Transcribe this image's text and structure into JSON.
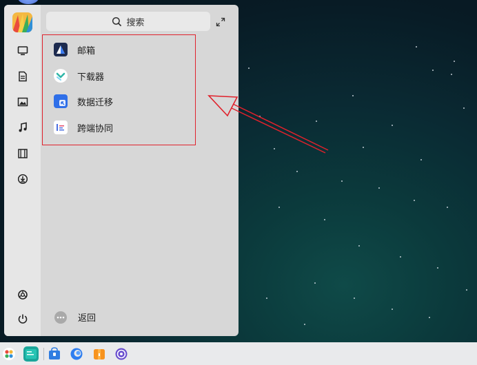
{
  "search": {
    "label": "搜索",
    "icon": "search-icon"
  },
  "sidebar": {
    "icons": [
      "app-logo-icon",
      "computer-icon",
      "document-icon",
      "image-icon",
      "music-icon",
      "video-icon",
      "download-icon",
      "settings-icon",
      "power-icon"
    ]
  },
  "apps": [
    {
      "label": "邮箱",
      "icon": "mail-app-icon"
    },
    {
      "label": "下载器",
      "icon": "downloader-app-icon"
    },
    {
      "label": "数据迁移",
      "icon": "data-migration-app-icon"
    },
    {
      "label": "跨端协同",
      "icon": "cross-device-app-icon"
    }
  ],
  "back": {
    "label": "返回"
  },
  "colors": {
    "highlight": "#e0212b",
    "panel": "#d7d7d7",
    "taskbar": "#e9eaec"
  },
  "taskbar": {
    "icons": [
      "launcher-icon",
      "terminal-icon",
      "app-store-icon",
      "browser-icon",
      "file-manager-icon",
      "system-settings-icon"
    ]
  }
}
